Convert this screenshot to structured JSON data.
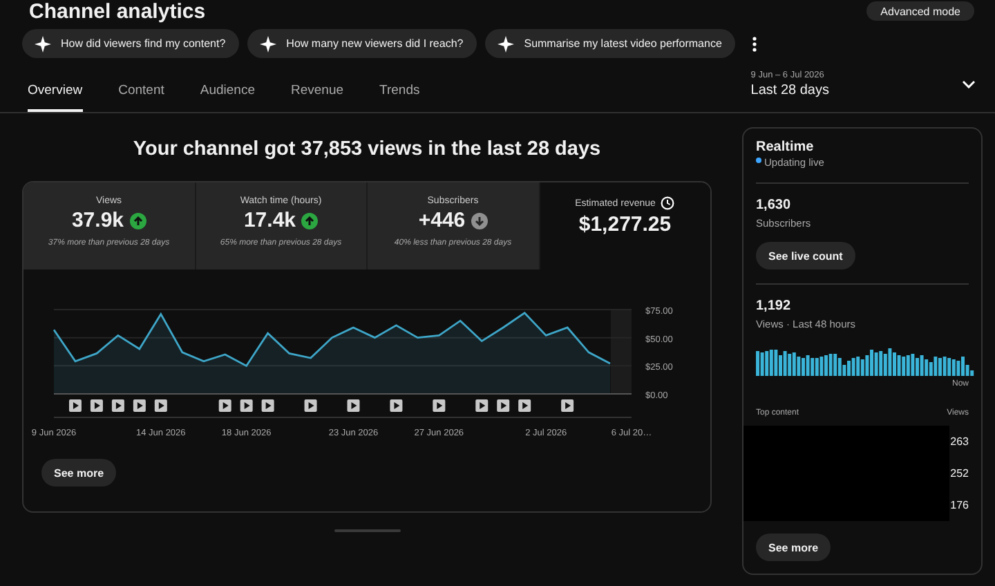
{
  "page_title": "Channel analytics",
  "advanced_button": "Advanced mode",
  "chips": [
    "How did viewers find my content?",
    "How many new viewers did I reach?",
    "Summarise my latest video performance"
  ],
  "tabs": [
    {
      "label": "Overview",
      "selected": true
    },
    {
      "label": "Content",
      "selected": false
    },
    {
      "label": "Audience",
      "selected": false
    },
    {
      "label": "Revenue",
      "selected": false
    },
    {
      "label": "Trends",
      "selected": false
    }
  ],
  "date_range": {
    "dates": "9 Jun – 6 Jul 2026",
    "label": "Last 28 days"
  },
  "headline": "Your channel got 37,853 views in the last 28 days",
  "metrics": [
    {
      "label": "Views",
      "value": "37.9k",
      "trend_up": true,
      "note": "37% more than previous 28 days",
      "selected": false,
      "clock": false
    },
    {
      "label": "Watch time (hours)",
      "value": "17.4k",
      "trend_up": true,
      "note": "65% more than previous 28 days",
      "selected": false,
      "clock": false
    },
    {
      "label": "Subscribers",
      "value": "+446",
      "trend_down": true,
      "note": "40% less than previous 28 days",
      "selected": false,
      "clock": false
    },
    {
      "label": "Estimated revenue",
      "value": "$1,277.25",
      "selected": true,
      "clock": true
    }
  ],
  "chart_data": {
    "type": "area",
    "categories": [
      "9 Jun 2026",
      null,
      null,
      null,
      null,
      "14 Jun 2026",
      null,
      null,
      null,
      "18 Jun 2026",
      null,
      null,
      null,
      null,
      "23 Jun 2026",
      null,
      null,
      null,
      "27 Jun 2026",
      null,
      null,
      null,
      null,
      "2 Jul 2026",
      null,
      null,
      null,
      "6 Jul 20…"
    ],
    "series": [
      {
        "color": "#3ea6c8",
        "values": [
          57,
          29,
          36,
          52,
          40,
          71,
          37,
          29,
          35,
          25,
          54,
          36,
          32,
          50,
          59,
          50,
          61,
          50,
          52,
          65,
          47,
          59,
          72,
          52,
          59,
          37,
          27,
          null
        ]
      }
    ],
    "ylim": [
      0,
      75
    ],
    "yticks": [
      {
        "value": 0,
        "label": "$0.00"
      },
      {
        "value": 25,
        "label": "$25.00"
      },
      {
        "value": 50,
        "label": "$50.00"
      },
      {
        "value": 75,
        "label": "$75.00"
      }
    ]
  },
  "timeline_slots": [
    {
      "kind": "empty"
    },
    {
      "kind": "video"
    },
    {
      "kind": "video"
    },
    {
      "kind": "video"
    },
    {
      "kind": "video"
    },
    {
      "kind": "video"
    },
    {
      "kind": "empty"
    },
    {
      "kind": "empty"
    },
    {
      "kind": "video"
    },
    {
      "kind": "video"
    },
    {
      "kind": "video"
    },
    {
      "kind": "empty"
    },
    {
      "kind": "video"
    },
    {
      "kind": "empty"
    },
    {
      "kind": "video"
    },
    {
      "kind": "empty"
    },
    {
      "kind": "video"
    },
    {
      "kind": "empty"
    },
    {
      "kind": "video"
    },
    {
      "kind": "empty"
    },
    {
      "kind": "video"
    },
    {
      "kind": "video"
    },
    {
      "kind": "video"
    },
    {
      "kind": "empty"
    },
    {
      "kind": "video"
    },
    {
      "kind": "empty"
    },
    {
      "kind": "empty"
    },
    {
      "kind": "empty"
    }
  ],
  "see_more": "See more",
  "realtime": {
    "title": "Realtime",
    "status": "Updating live",
    "subscribers": "1,630",
    "subscribers_label": "Subscribers",
    "live_button": "See live count",
    "views": "1,192",
    "views_label": "Views · Last 48 hours",
    "now_label": "Now",
    "top_content_label": "Top content",
    "views_column": "Views",
    "top_views": [
      "263",
      "252",
      "176"
    ],
    "see_more": "See more"
  }
}
